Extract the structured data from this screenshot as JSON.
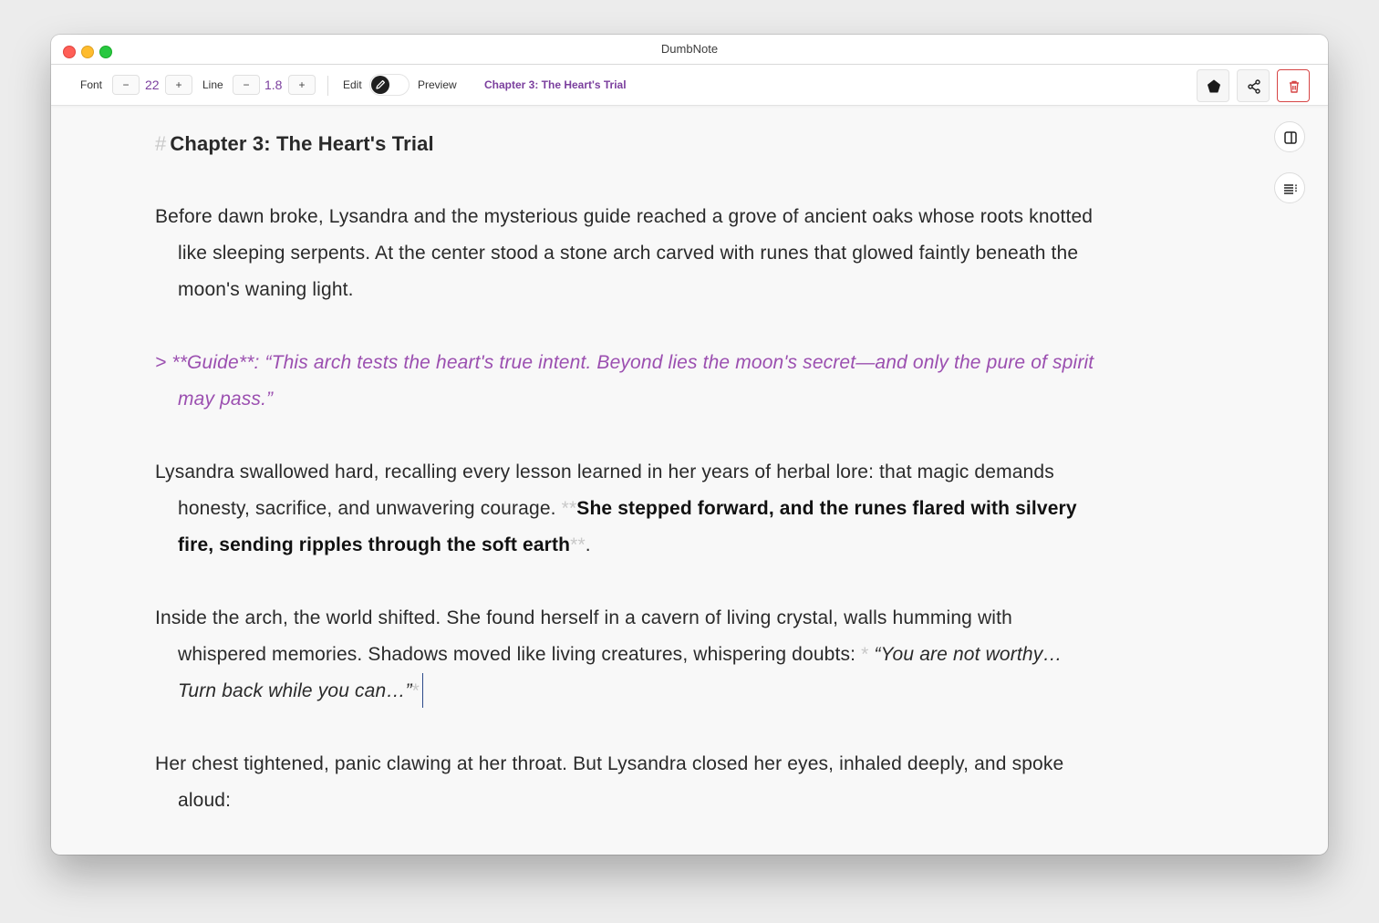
{
  "window": {
    "title": "DumbNote"
  },
  "toolbar": {
    "font_label": "Font",
    "font_decrease": "−",
    "font_size": "22",
    "font_increase": "+",
    "line_label": "Line",
    "line_decrease": "−",
    "line_height": "1.8",
    "line_increase": "+",
    "edit_label": "Edit",
    "preview_label": "Preview",
    "document_title": "Chapter 3: The Heart's Trial"
  },
  "icons": {
    "pin": "pin-icon",
    "share": "share-icon",
    "trash": "trash-icon",
    "sidebar_toggle": "sidebar-toggle-icon",
    "outline": "outline-icon",
    "pencil": "pencil-icon"
  },
  "colors": {
    "accent": "#7b3f9e",
    "quote": "#9b4fb0",
    "danger": "#d64545",
    "markdown_marker": "#c8c8c8"
  },
  "editor": {
    "heading_marker": "#",
    "heading_text": "Chapter 3: The Heart's Trial",
    "p1": "Before dawn broke, Lysandra and the mysterious guide reached a grove of ancient oaks whose roots knotted like sleeping serpents. At the center stood a stone arch carved with runes that glowed faintly beneath the moon's waning light.",
    "quote": "> **Guide**: “This arch tests the heart's true intent. Beyond lies the moon's secret—and only the pure of spirit may pass.”",
    "p3_start": "Lysandra swallowed hard, recalling every lesson learned in her years of herbal lore: that magic demands honesty, sacrifice, and unwavering courage. ",
    "bold_marker": "**",
    "p3_bold": "She stepped forward, and the runes flared with silvery fire, sending ripples through the soft earth",
    "p3_end": ".",
    "p4_start": "Inside the arch, the world shifted. She found herself in a cavern of living crystal, walls humming with whispered memories. Shadows moved like living creatures, whispering doubts: ",
    "italic_marker": "*",
    "p4_italic": "“You are not worthy… Turn back while you can…”",
    "p5": "Her chest tightened, panic clawing at her throat. But Lysandra closed her eyes, inhaled deeply, and spoke aloud:"
  }
}
